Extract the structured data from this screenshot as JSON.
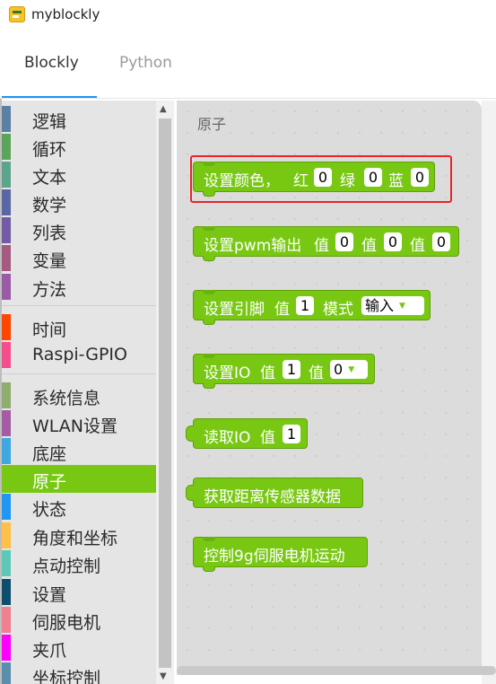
{
  "window": {
    "title": "myblockly"
  },
  "tabs": [
    {
      "label": "Blockly",
      "active": true
    },
    {
      "label": "Python",
      "active": false
    }
  ],
  "toolbox": {
    "categories": [
      {
        "label": "逻辑",
        "color": "#5b80a5"
      },
      {
        "label": "循环",
        "color": "#5ba55b"
      },
      {
        "label": "文本",
        "color": "#5ba58c"
      },
      {
        "label": "数学",
        "color": "#5b67a5"
      },
      {
        "label": "列表",
        "color": "#745ba5"
      },
      {
        "label": "变量",
        "color": "#a55b80"
      },
      {
        "label": "方法",
        "color": "#995ba5"
      },
      {
        "label": "时间",
        "color": "#ff4500"
      },
      {
        "label": "Raspi-GPIO",
        "color": "#f44f8c"
      },
      {
        "label": "系统信息",
        "color": "#8fad6e"
      },
      {
        "label": "WLAN设置",
        "color": "#a55ba5"
      },
      {
        "label": "底座",
        "color": "#40a8e0"
      },
      {
        "label": "原子",
        "color": "#78c813",
        "selected": true
      },
      {
        "label": "状态",
        "color": "#2196f3"
      },
      {
        "label": "角度和坐标",
        "color": "#ffc04a"
      },
      {
        "label": "点动控制",
        "color": "#5ec8b8"
      },
      {
        "label": "设置",
        "color": "#0d4d6e"
      },
      {
        "label": "伺服电机",
        "color": "#f08090"
      },
      {
        "label": "夹爪",
        "color": "#ff00ff"
      },
      {
        "label": "坐标控制",
        "color": "#5b8dac"
      }
    ]
  },
  "flyout": {
    "title": "原子",
    "blocks": {
      "set_color": {
        "label": "设置颜色，",
        "r_label": "红",
        "r": "0",
        "g_label": "绿",
        "g": "0",
        "b_label": "蓝",
        "b": "0"
      },
      "set_pwm": {
        "label": "设置pwm输出",
        "v1_label": "值",
        "v1": "0",
        "v2_label": "值",
        "v2": "0",
        "v3_label": "值",
        "v3": "0"
      },
      "set_pin": {
        "label": "设置引脚",
        "v_label": "值",
        "v": "1",
        "mode_label": "模式",
        "mode": "输入"
      },
      "set_io": {
        "label": "设置IO",
        "v_label": "值",
        "v": "1",
        "v2_label": "值",
        "v2": "0"
      },
      "read_io": {
        "label": "读取IO",
        "v_label": "值",
        "v": "1"
      },
      "get_distance": {
        "label": "获取距离传感器数据"
      },
      "servo_9g": {
        "label": "控制9g伺服电机运动"
      }
    }
  },
  "colors": {
    "block_green": "#78c813",
    "highlight_red": "#e8262a",
    "tab_underline": "#2196f3"
  },
  "icons": {
    "app": "myblockly-app-icon",
    "scroll_up": "triangle-up",
    "scroll_down": "triangle-down"
  }
}
